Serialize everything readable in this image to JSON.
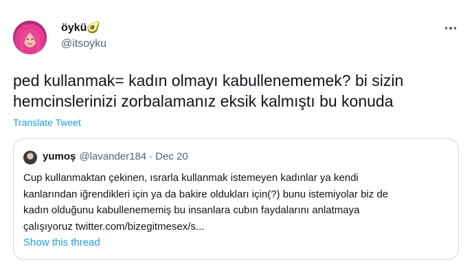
{
  "tweet": {
    "author": {
      "display_name": "öykü",
      "emoji": "🥑",
      "handle": "@itsoyku"
    },
    "text": "ped kullanmak= kadın olmayı kabullenememek? bi sizin\nhemcinslerinizi zorbalamanız eksik kalmıştı bu konuda",
    "translate_label": "Translate Tweet",
    "more_icon": "more-horizontal-icon"
  },
  "quoted_tweet": {
    "author": {
      "display_name": "yumoş",
      "handle": "@lavander184"
    },
    "separator": "·",
    "date": "Dec 20",
    "text": "Cup kullanmaktan çekinen, ısrarla kullanmak istemeyen kadınlar ya kendi\nkanlarından iğrendikleri için ya da bakire oldukları için(?) bunu istemiyolar biz de\nkadın olduğunu kabullenememiş bu insanlara cubın faydalarını anlatmaya\nçalışıyoruz twitter.com/bizegitmesex/s...",
    "show_thread_label": "Show this thread"
  },
  "colors": {
    "text_primary": "#0f1419",
    "text_secondary": "#536471",
    "link": "#1d9bf0",
    "border": "#cfd9de"
  }
}
